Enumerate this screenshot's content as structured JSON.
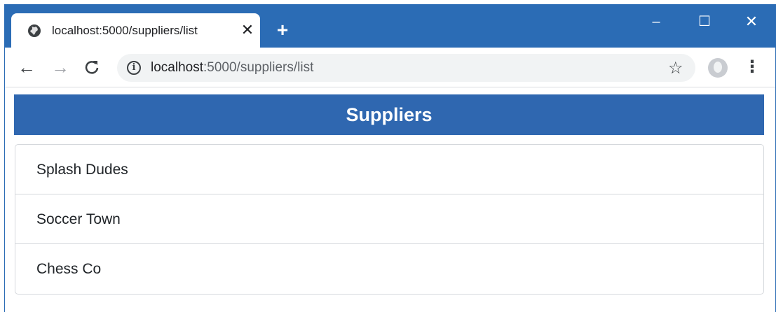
{
  "browser": {
    "tab": {
      "title": "localhost:5000/suppliers/list",
      "favicon_icon": "globe-icon",
      "close_glyph": "✕"
    },
    "new_tab_glyph": "+",
    "window_controls": {
      "minimize": "–",
      "maximize": "☐",
      "close": "✕"
    },
    "toolbar": {
      "back_icon": "←",
      "forward_icon": "→",
      "reload_icon": "C",
      "info_glyph": "i",
      "url_host": "localhost",
      "url_rest": ":5000/suppliers/list",
      "star_icon": "☆",
      "menu_icon": "⋮"
    }
  },
  "page": {
    "header": "Suppliers",
    "suppliers": [
      "Splash Dudes",
      "Soccer Town",
      "Chess Co"
    ]
  },
  "colors": {
    "titlebar": "#2b6cb5",
    "header_bg": "#2f67b0"
  }
}
